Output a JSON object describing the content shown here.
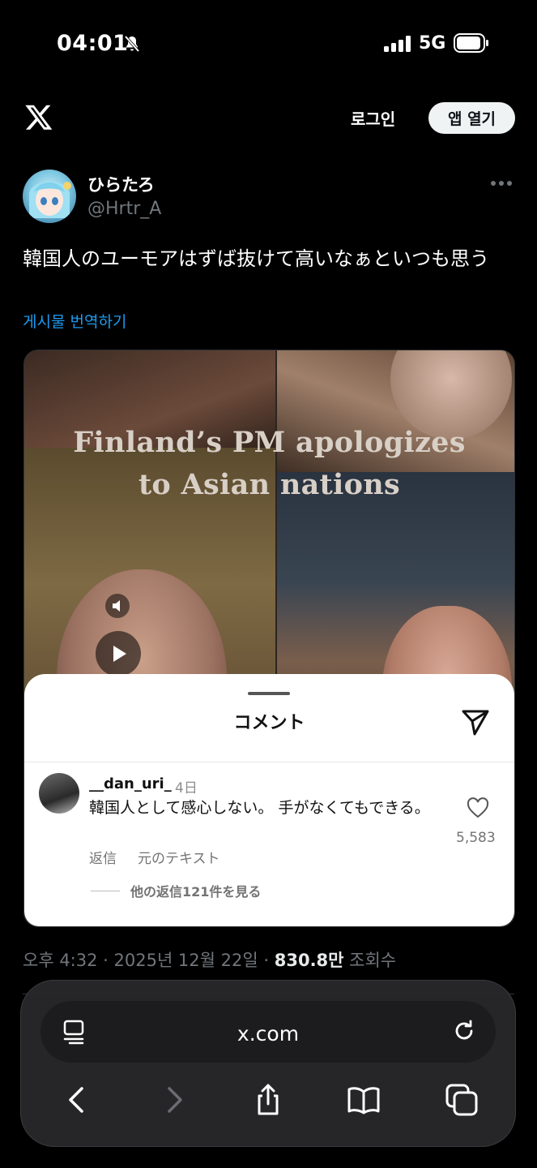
{
  "status_bar": {
    "time": "04:01",
    "network": "5G"
  },
  "header": {
    "login_label": "로그인",
    "open_app_label": "앱 열기"
  },
  "post": {
    "author_name": "ひらたろ",
    "author_handle": "@Hrtr_A",
    "text": "韓国人のユーモアはずば抜けて高いなぁといつも思う",
    "translate_label": "게시물 번역하기",
    "media": {
      "title_line1": "Finland’s PM apologizes",
      "title_line2": "to Asian nations",
      "comment_sheet": {
        "title": "コメント",
        "comment": {
          "username": "__dan_uri_",
          "date": "4日",
          "text": "韓国人として感心しない。 手がなくてもできる。",
          "reply_label": "返信",
          "original_text_label": "元のテキスト",
          "likes": "5,583",
          "more_replies_label": "他の返信121件を見る"
        }
      }
    },
    "meta": {
      "time_date": "오후 4:32 · 2025년 12월 22일 · ",
      "views_value": "830.8만",
      "views_label": " 조회수"
    }
  },
  "browser": {
    "url": "x.com"
  },
  "colors": {
    "accent_link": "#1d9bf0",
    "background": "#000000"
  }
}
